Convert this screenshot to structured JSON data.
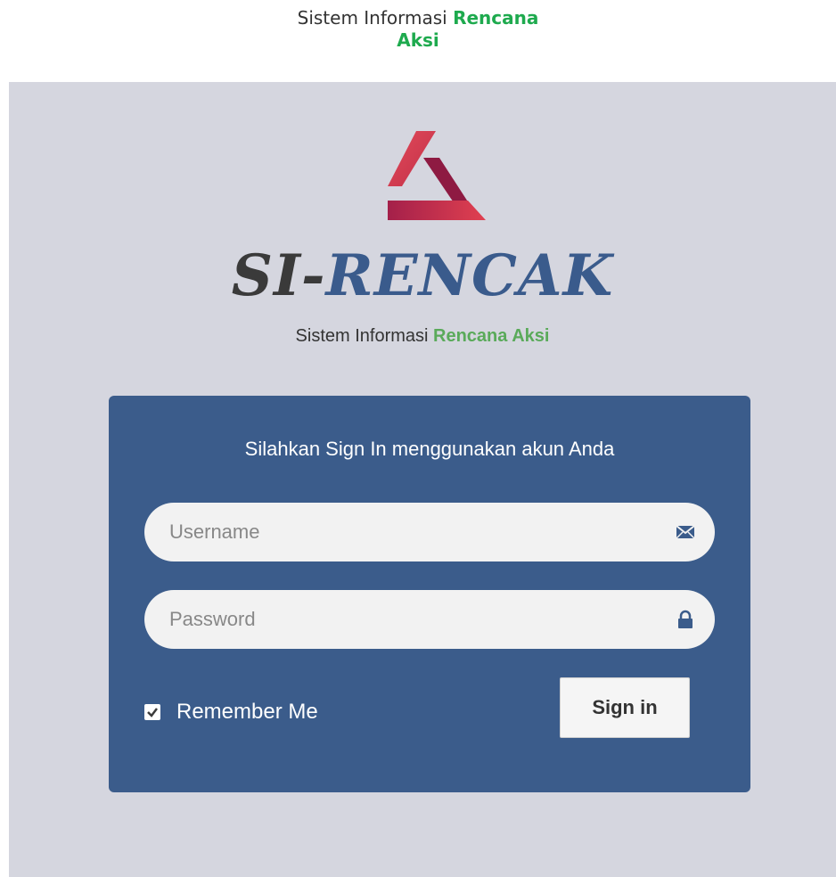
{
  "top_title": {
    "line1_text": "Sistem Informasi ",
    "line1_accent": "Rencana",
    "line2_accent": "Aksi"
  },
  "brand": {
    "logo_icon": "triangle-logo-icon",
    "name_part1": "SI-",
    "name_part2": "RENCAK",
    "subtitle_text": "Sistem Informasi ",
    "subtitle_accent": "Rencana Aksi"
  },
  "login": {
    "heading": "Silahkan Sign In menggunakan akun Anda",
    "username": {
      "value": "",
      "placeholder": "Username",
      "icon": "envelope-icon"
    },
    "password": {
      "value": "",
      "placeholder": "Password",
      "icon": "lock-icon"
    },
    "remember_label": "Remember Me",
    "remember_checked": true,
    "signin_label": "Sign in"
  },
  "colors": {
    "accent_green": "#1eaa4e",
    "panel_bg": "#d5d6df",
    "login_box_bg": "#3b5c8b",
    "brand_blue": "#3a5b8c"
  }
}
